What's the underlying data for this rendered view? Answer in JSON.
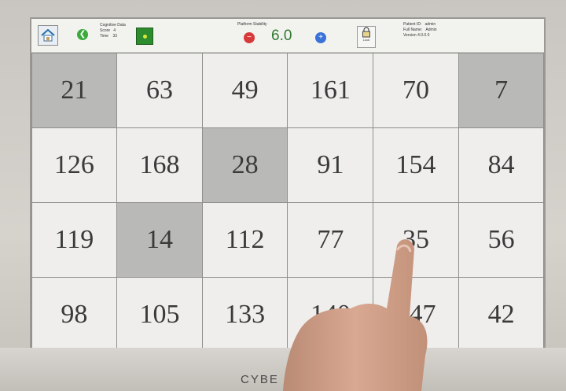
{
  "header": {
    "cognitive_title": "Cognitive Data",
    "score_label": "Score",
    "score_value": "4",
    "time_label": "Time",
    "time_value": "33",
    "stability_label": "Platform Stability",
    "stability_value": "6.0",
    "lock_label": "Lock",
    "patient_id_label": "Patient ID:",
    "patient_id_value": "admin",
    "full_name_label": "Full Name:",
    "full_name_value": "Admin",
    "version": "Version 4.0.0.0"
  },
  "grid": {
    "cells": [
      {
        "value": "21",
        "highlighted": true
      },
      {
        "value": "63",
        "highlighted": false
      },
      {
        "value": "49",
        "highlighted": false
      },
      {
        "value": "161",
        "highlighted": false
      },
      {
        "value": "70",
        "highlighted": false
      },
      {
        "value": "7",
        "highlighted": true
      },
      {
        "value": "126",
        "highlighted": false
      },
      {
        "value": "168",
        "highlighted": false
      },
      {
        "value": "28",
        "highlighted": true
      },
      {
        "value": "91",
        "highlighted": false
      },
      {
        "value": "154",
        "highlighted": false
      },
      {
        "value": "84",
        "highlighted": false
      },
      {
        "value": "119",
        "highlighted": false
      },
      {
        "value": "14",
        "highlighted": true
      },
      {
        "value": "112",
        "highlighted": false
      },
      {
        "value": "77",
        "highlighted": false
      },
      {
        "value": "35",
        "highlighted": false
      },
      {
        "value": "56",
        "highlighted": false
      },
      {
        "value": "98",
        "highlighted": false
      },
      {
        "value": "105",
        "highlighted": false
      },
      {
        "value": "133",
        "highlighted": false
      },
      {
        "value": "140",
        "highlighted": false
      },
      {
        "value": "147",
        "highlighted": false
      },
      {
        "value": "42",
        "highlighted": false
      }
    ]
  },
  "monitor": {
    "brand_text": "CYBE"
  },
  "colors": {
    "highlight_cell": "#b9b9b7",
    "normal_cell": "#efeeec",
    "stability_value": "#2f7a2f"
  }
}
